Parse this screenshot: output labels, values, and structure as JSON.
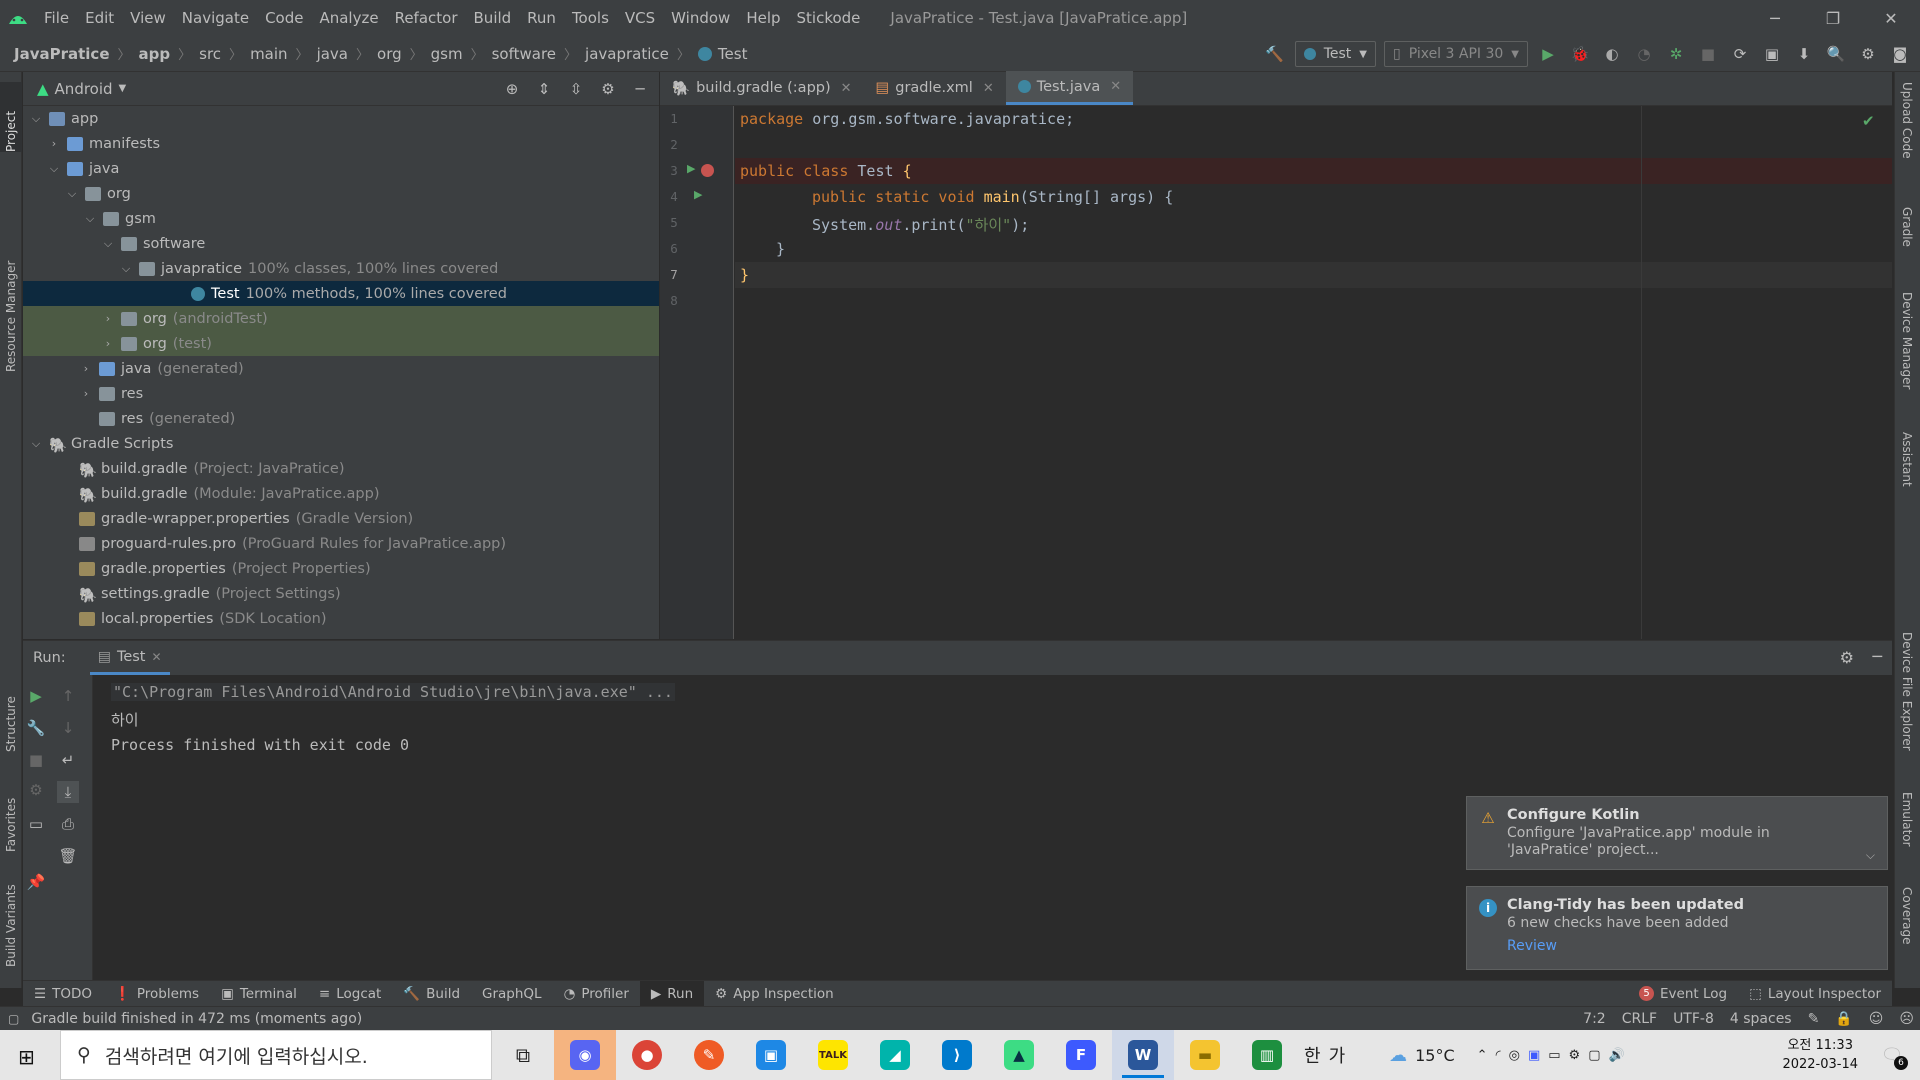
{
  "window": {
    "title": "JavaPratice - Test.java [JavaPratice.app]",
    "menu": [
      "File",
      "Edit",
      "View",
      "Navigate",
      "Code",
      "Analyze",
      "Refactor",
      "Build",
      "Run",
      "Tools",
      "VCS",
      "Window",
      "Help",
      "Stickode"
    ],
    "controls": {
      "minimize": "─",
      "restore": "❐",
      "close": "✕"
    }
  },
  "breadcrumb": [
    "JavaPratice",
    "app",
    "src",
    "main",
    "java",
    "org",
    "gsm",
    "software",
    "javapratice",
    "Test"
  ],
  "toolbar": {
    "run_config": "Test",
    "device": "Pixel 3 API 30"
  },
  "left_strip": [
    "Project",
    "Resource Manager",
    "Structure",
    "Favorites",
    "Build Variants"
  ],
  "right_strip": [
    "Upload Code",
    "Gradle",
    "Device Manager",
    "Assistant",
    "Device File Explorer",
    "Emulator",
    "Coverage"
  ],
  "project": {
    "view": "Android",
    "tree": [
      {
        "label": "app",
        "extra": ""
      },
      {
        "label": "manifests",
        "extra": ""
      },
      {
        "label": "java",
        "extra": ""
      },
      {
        "label": "org",
        "extra": ""
      },
      {
        "label": "gsm",
        "extra": ""
      },
      {
        "label": "software",
        "extra": ""
      },
      {
        "label": "javapratice",
        "extra": "100% classes, 100% lines covered"
      },
      {
        "label": "Test",
        "extra": "100% methods, 100% lines covered"
      },
      {
        "label": "org",
        "extra": "(androidTest)"
      },
      {
        "label": "org",
        "extra": "(test)"
      },
      {
        "label": "java",
        "extra": "(generated)"
      },
      {
        "label": "res",
        "extra": ""
      },
      {
        "label": "res",
        "extra": "(generated)"
      },
      {
        "label": "Gradle Scripts",
        "extra": ""
      },
      {
        "label": "build.gradle",
        "extra": "(Project: JavaPratice)"
      },
      {
        "label": "build.gradle",
        "extra": "(Module: JavaPratice.app)"
      },
      {
        "label": "gradle-wrapper.properties",
        "extra": "(Gradle Version)"
      },
      {
        "label": "proguard-rules.pro",
        "extra": "(ProGuard Rules for JavaPratice.app)"
      },
      {
        "label": "gradle.properties",
        "extra": "(Project Properties)"
      },
      {
        "label": "settings.gradle",
        "extra": "(Project Settings)"
      },
      {
        "label": "local.properties",
        "extra": "(SDK Location)"
      }
    ]
  },
  "tabs": [
    "build.gradle (:app)",
    "gradle.xml",
    "Test.java"
  ],
  "code": {
    "line_numbers": [
      "1",
      "2",
      "3",
      "4",
      "5",
      "6",
      "7",
      "8"
    ],
    "l1_kw": "package",
    "l1_rest": " org.gsm.software.javapratice;",
    "l3_kw": "public class",
    "l3_name": " Test ",
    "l3_brace": "{",
    "l4_kw": "public static void",
    "l4_fn": " main",
    "l4_rest": "(String[] args) {",
    "l5_a": "System.",
    "l5_out": "out",
    "l5_b": ".print(",
    "l5_str": "\"하이\"",
    "l5_c": ");",
    "l6": "}",
    "l7": "}"
  },
  "run": {
    "label": "Run:",
    "tab": "Test",
    "output": [
      "\"C:\\Program Files\\Android\\Android Studio\\jre\\bin\\java.exe\" ...",
      "하이",
      "Process finished with exit code 0"
    ]
  },
  "notifications": [
    {
      "title": "Configure Kotlin",
      "body": "Configure 'JavaPratice.app' module in 'JavaPratice' project...",
      "link": ""
    },
    {
      "title": "Clang-Tidy has been updated",
      "body": "6 new checks have been added",
      "link": "Review"
    }
  ],
  "bottom_tools": [
    "TODO",
    "Problems",
    "Terminal",
    "Logcat",
    "Build",
    "GraphQL",
    "Profiler",
    "Run",
    "App Inspection"
  ],
  "bottom_right": {
    "event_log": "Event Log",
    "event_count": "5",
    "layout_inspector": "Layout Inspector"
  },
  "status": {
    "message": "Gradle build finished in 472 ms (moments ago)",
    "position": "7:2",
    "line_sep": "CRLF",
    "encoding": "UTF-8",
    "indent": "4 spaces"
  },
  "taskbar": {
    "search_placeholder": "검색하려면 여기에 입력하십시오.",
    "ime_han": "한",
    "ime_ga": "가",
    "temperature": "15°C",
    "time": "오전 11:33",
    "date": "2022-03-14",
    "notif_count": "6"
  }
}
